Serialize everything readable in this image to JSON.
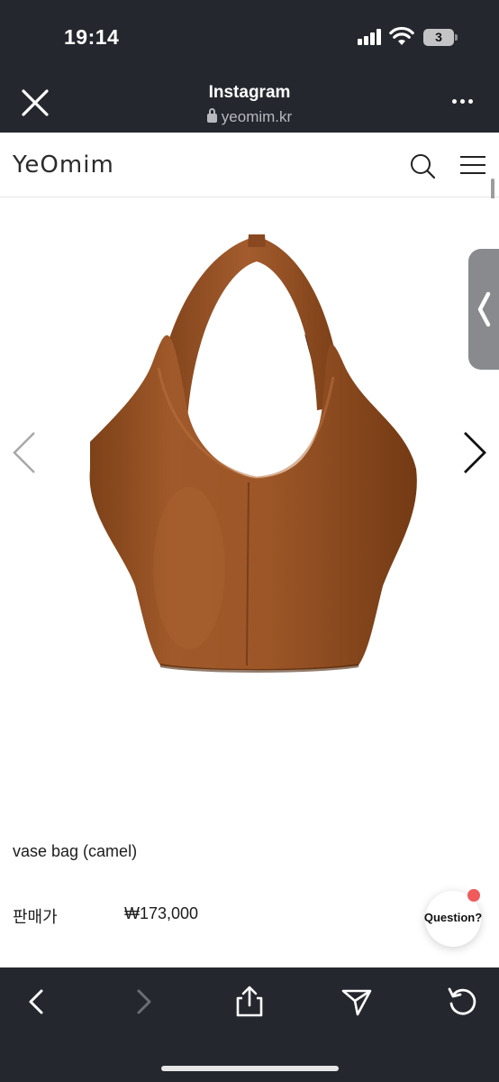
{
  "status_bar": {
    "time": "19:14",
    "battery_level": "3",
    "icons": [
      "signal-icon",
      "wifi-icon",
      "battery-icon"
    ]
  },
  "browser_header": {
    "title": "Instagram",
    "url": "yeomim.kr",
    "icons": [
      "close-icon",
      "lock-icon",
      "more-icon"
    ]
  },
  "site": {
    "logo_text": "YeOmim",
    "icons": [
      "search-icon",
      "menu-icon"
    ]
  },
  "gallery": {
    "icons": [
      "chevron-left-icon",
      "chevron-right-icon",
      "side-tab-chevron-icon"
    ],
    "image_subject": "bag-photo"
  },
  "product": {
    "name": "vase bag (camel)",
    "price_label": "판매가",
    "price_value": "₩173,000"
  },
  "chat": {
    "button_label": "Question?"
  },
  "toolbar": {
    "icons": [
      "back-icon",
      "forward-icon",
      "share-icon",
      "send-icon",
      "reload-icon"
    ]
  },
  "colors": {
    "chrome_dark": "#24272e",
    "bag_camel": "#9a5527",
    "notification": "#ef5b5b"
  }
}
